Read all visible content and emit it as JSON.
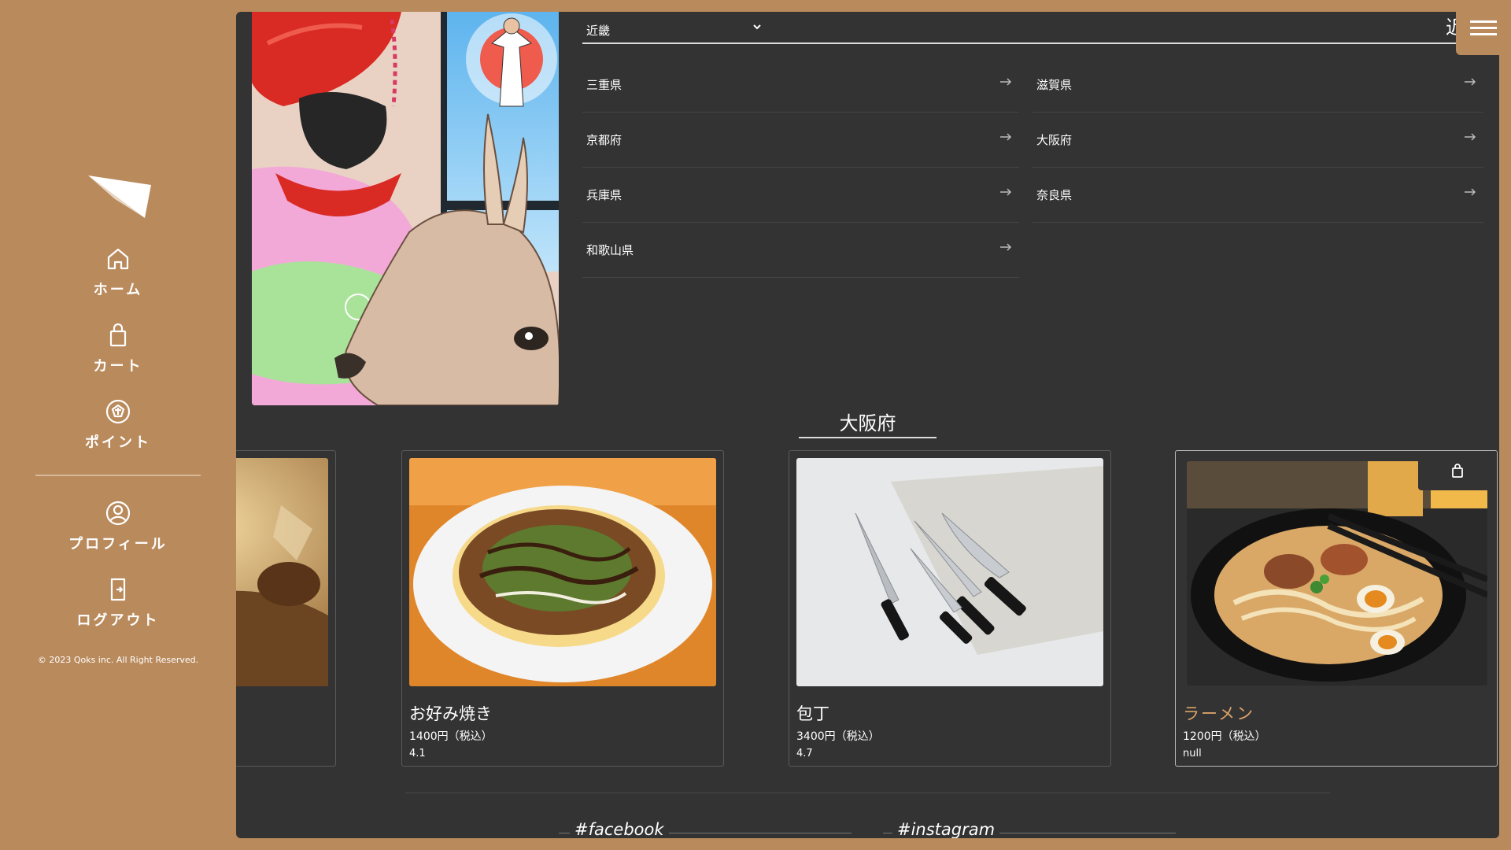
{
  "sidebar": {
    "nav": [
      {
        "label": "ホーム",
        "icon": "home-icon"
      },
      {
        "label": "カート",
        "icon": "shopping-bag-icon"
      },
      {
        "label": "ポイント",
        "icon": "points-badge-icon"
      },
      {
        "label": "プロフィール",
        "icon": "user-circle-icon"
      },
      {
        "label": "ログアウト",
        "icon": "logout-icon"
      }
    ],
    "copyright": "© 2023 Qoks inc. All Right Reserved."
  },
  "region": {
    "selected": "近畿",
    "heading_partial": "近",
    "prefectures": [
      "三重県",
      "滋賀県",
      "京都府",
      "大阪府",
      "兵庫県",
      "奈良県",
      "和歌山県"
    ]
  },
  "section": {
    "title": "大阪府"
  },
  "products": [
    {
      "name": "",
      "price": "",
      "rating": ""
    },
    {
      "name": "お好み焼き",
      "price": "1400円（税込）",
      "rating": "4.1"
    },
    {
      "name": "包丁",
      "price": "3400円（税込）",
      "rating": "4.7"
    },
    {
      "name": "ラーメン",
      "price": "1200円（税込）",
      "rating": "null"
    }
  ],
  "footer": {
    "facebook": "#facebook",
    "instagram": "#instagram"
  },
  "colors": {
    "background": "#b98a5c",
    "panel": "#333333",
    "accent": "#d9a16a"
  }
}
